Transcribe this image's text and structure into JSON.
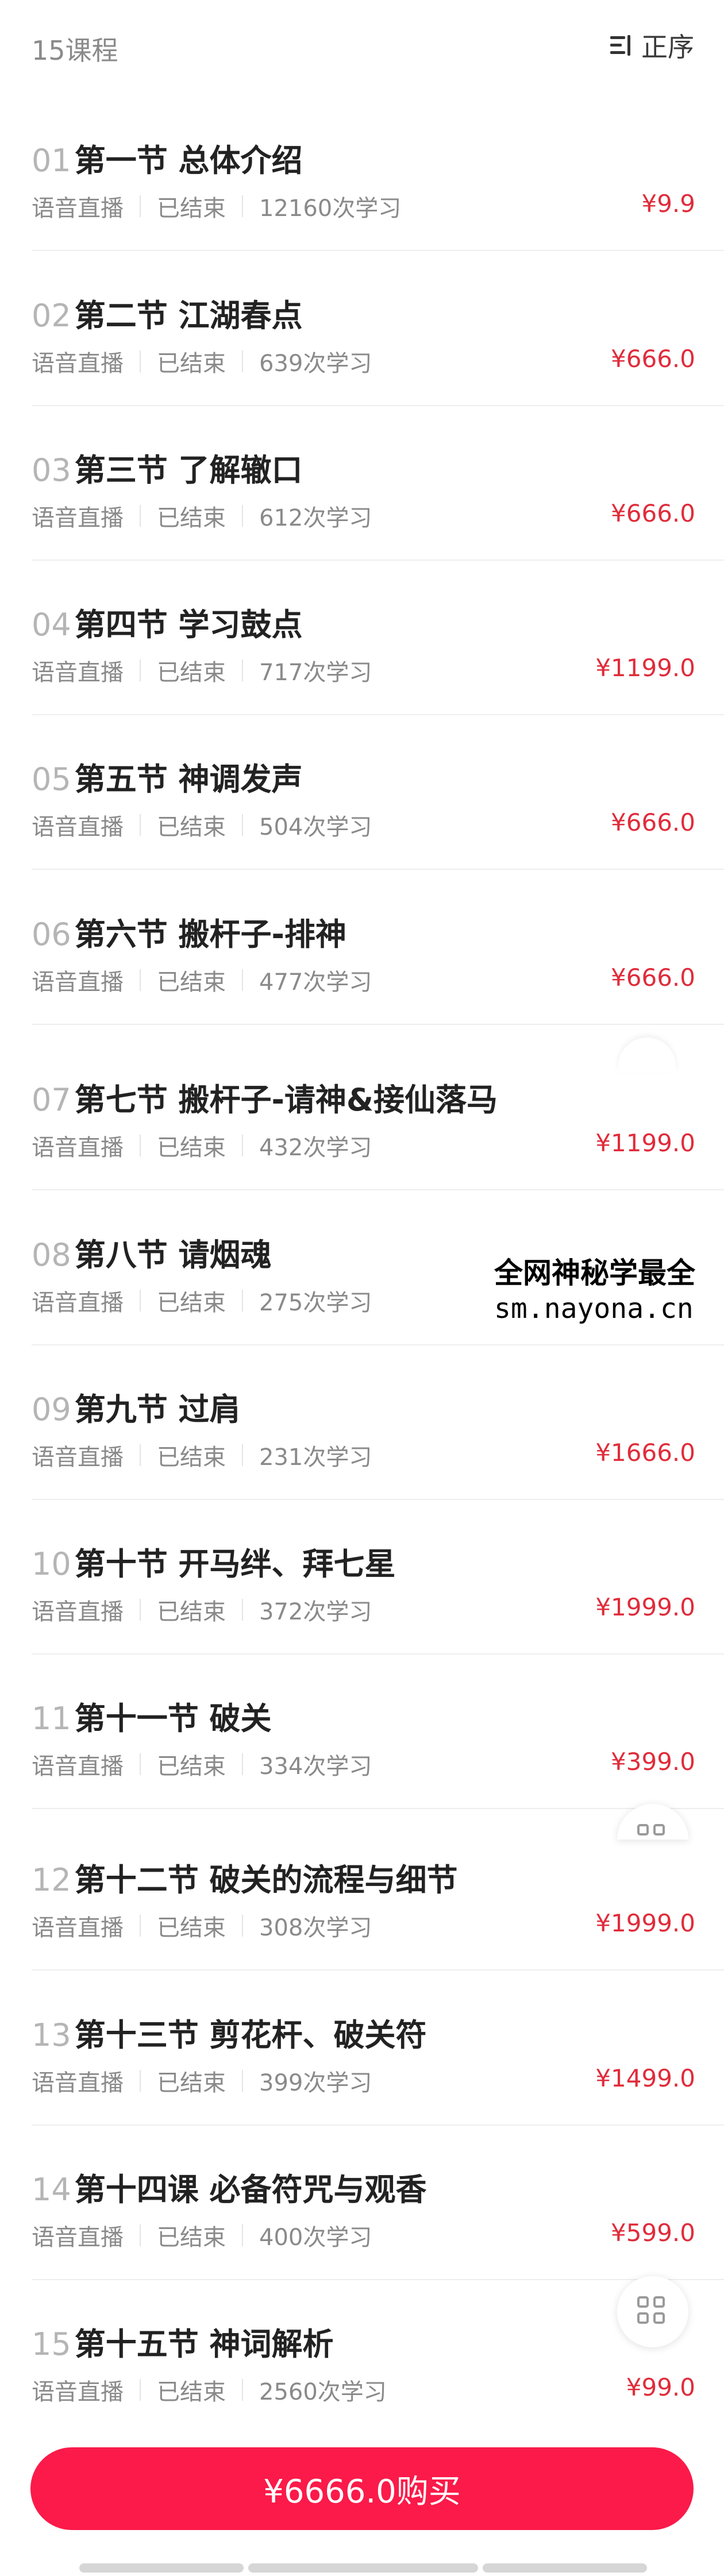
{
  "header": {
    "count_label": "15课程",
    "sort_label": "正序",
    "sort_icon": "sort-order-icon"
  },
  "courses": [
    {
      "num": "01",
      "title": "第一节 总体介绍",
      "type": "语音直播",
      "status": "已结束",
      "learners": "12160次学习",
      "price": "¥9.9"
    },
    {
      "num": "02",
      "title": "第二节 江湖春点",
      "type": "语音直播",
      "status": "已结束",
      "learners": "639次学习",
      "price": "¥666.0"
    },
    {
      "num": "03",
      "title": "第三节 了解辙口",
      "type": "语音直播",
      "status": "已结束",
      "learners": "612次学习",
      "price": "¥666.0"
    },
    {
      "num": "04",
      "title": "第四节 学习鼓点",
      "type": "语音直播",
      "status": "已结束",
      "learners": "717次学习",
      "price": "¥1199.0"
    },
    {
      "num": "05",
      "title": "第五节 神调发声",
      "type": "语音直播",
      "status": "已结束",
      "learners": "504次学习",
      "price": "¥666.0"
    },
    {
      "num": "06",
      "title": "第六节 搬杆子-排神",
      "type": "语音直播",
      "status": "已结束",
      "learners": "477次学习",
      "price": "¥666.0"
    },
    {
      "num": "07",
      "title": "第七节 搬杆子-请神&接仙落马",
      "type": "语音直播",
      "status": "已结束",
      "learners": "432次学习",
      "price": "¥1199.0"
    },
    {
      "num": "08",
      "title": "第八节 请烟魂",
      "type": "语音直播",
      "status": "已结束",
      "learners": "275次学习",
      "price": ""
    },
    {
      "num": "09",
      "title": "第九节 过肩",
      "type": "语音直播",
      "status": "已结束",
      "learners": "231次学习",
      "price": "¥1666.0"
    },
    {
      "num": "10",
      "title": "第十节 开马绊、拜七星",
      "type": "语音直播",
      "status": "已结束",
      "learners": "372次学习",
      "price": "¥1999.0"
    },
    {
      "num": "11",
      "title": "第十一节 破关",
      "type": "语音直播",
      "status": "已结束",
      "learners": "334次学习",
      "price": "¥399.0"
    },
    {
      "num": "12",
      "title": "第十二节 破关的流程与细节",
      "type": "语音直播",
      "status": "已结束",
      "learners": "308次学习",
      "price": "¥1999.0"
    },
    {
      "num": "13",
      "title": "第十三节 剪花杆、破关符",
      "type": "语音直播",
      "status": "已结束",
      "learners": "399次学习",
      "price": "¥1499.0"
    },
    {
      "num": "14",
      "title": "第十四课 必备符咒与观香",
      "type": "语音直播",
      "status": "已结束",
      "learners": "400次学习",
      "price": "¥599.0"
    },
    {
      "num": "15",
      "title": "第十五节 神词解析",
      "type": "语音直播",
      "status": "已结束",
      "learners": "2560次学习",
      "price": "¥99.0"
    }
  ],
  "watermark": {
    "line1": "全网神秘学最全",
    "line2": "sm.nayona.cn"
  },
  "floating": {
    "icon": "grid-menu-icon"
  },
  "buy_button": {
    "label": "¥6666.0购买"
  },
  "colors": {
    "price": "#e02c3b",
    "buy_button": "#fb1a49",
    "muted_text": "#8a8a8a"
  }
}
